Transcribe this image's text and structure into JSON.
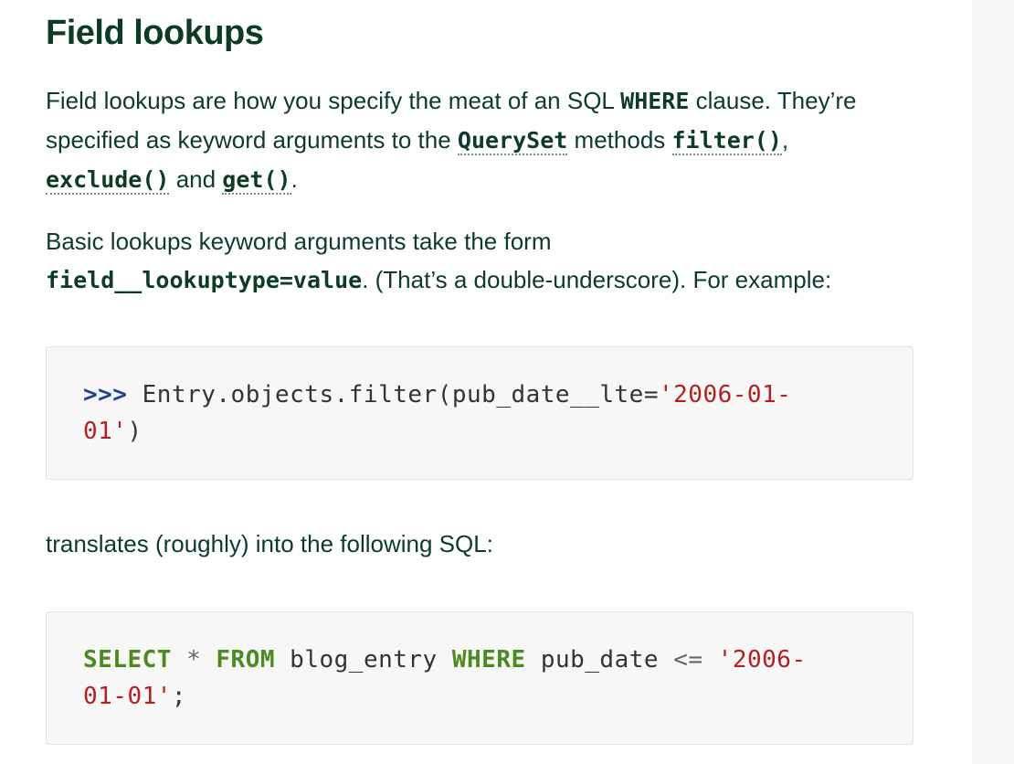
{
  "section": {
    "title": "Field lookups"
  },
  "para1": {
    "t1": "Field lookups are how you specify the meat of an SQL ",
    "c1": "WHERE",
    "t2": " clause. They’re specified as keyword arguments to the ",
    "c2": "QuerySet",
    "t3": " methods ",
    "c3": "filter()",
    "t4": ", ",
    "c4": "exclude()",
    "t5": " and ",
    "c5": "get()",
    "t6": "."
  },
  "para2": {
    "t1": "Basic lookups keyword arguments take the form ",
    "c1": "field__lookuptype=value",
    "t2": ". (That’s a double-underscore). For example:"
  },
  "code1": {
    "prompt": ">>>",
    "call": " Entry.objects.filter(pub_date__lte=",
    "string_a": "'2006-01-",
    "string_b": "01'",
    "close": ")"
  },
  "para3": {
    "text": "translates (roughly) into the following SQL:"
  },
  "code2": {
    "kw_select": "SELECT",
    "star": "*",
    "kw_from": "FROM",
    "table": "blog_entry",
    "kw_where": "WHERE",
    "column": "pub_date",
    "operator": "<=",
    "string_a": "'2006-",
    "string_b": "01-01'",
    "semicolon": ";"
  },
  "colors": {
    "text": "#0c3c26",
    "prompt": "#1c3ea0",
    "string": "#b41f1f",
    "keyword": "#4a8a1f",
    "code_bg": "#f7f7f7"
  }
}
